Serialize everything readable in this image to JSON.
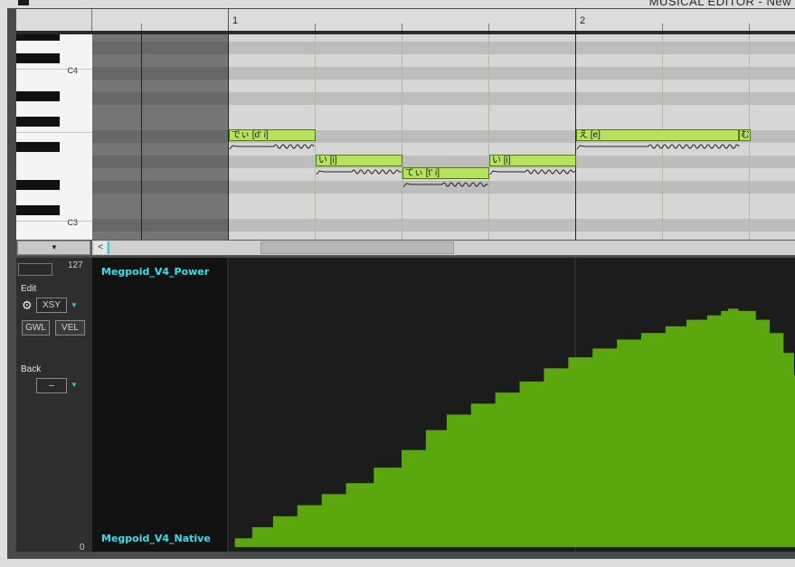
{
  "window": {
    "title": "MUSICAL EDITOR - New"
  },
  "ruler": {
    "bars": [
      "1",
      "2"
    ]
  },
  "keyboard": {
    "labels": [
      "C4",
      "C3"
    ]
  },
  "notes": [
    {
      "lyric": "でぃ [d' i]"
    },
    {
      "lyric": "い [i]"
    },
    {
      "lyric": "てぃ [t' i]"
    },
    {
      "lyric": "い [i]"
    },
    {
      "lyric": "え [e]"
    },
    {
      "lyric": "む"
    }
  ],
  "scroll": {
    "left_arrow": "<",
    "dropdown_arrow": "▼"
  },
  "control": {
    "max_value": "127",
    "min_value": "0",
    "edit_label": "Edit",
    "mode": "XSY",
    "gwl": "GWL",
    "vel": "VEL",
    "back_label": "Back",
    "back_value": "–"
  },
  "graph": {
    "top_voice": "Megpoid_V4_Power",
    "bottom_voice": "Megpoid_V4_Native"
  },
  "colors": {
    "note_fill": "#b5e35c",
    "curve_fill": "#5aa80e",
    "label_cyan": "#38e0f0"
  },
  "xsy_curve": {
    "y_range": [
      0,
      127
    ],
    "points": [
      [
        0,
        0
      ],
      [
        0.02,
        4
      ],
      [
        0.07,
        9
      ],
      [
        0.13,
        14
      ],
      [
        0.2,
        19
      ],
      [
        0.27,
        24
      ],
      [
        0.34,
        29
      ],
      [
        0.42,
        36
      ],
      [
        0.5,
        44
      ],
      [
        0.57,
        53
      ],
      [
        0.63,
        60
      ],
      [
        0.7,
        65
      ],
      [
        0.77,
        70
      ],
      [
        0.84,
        75
      ],
      [
        0.91,
        81
      ],
      [
        0.98,
        86
      ],
      [
        1.05,
        90
      ],
      [
        1.12,
        94
      ],
      [
        1.19,
        97
      ],
      [
        1.26,
        100
      ],
      [
        1.32,
        103
      ],
      [
        1.38,
        105
      ],
      [
        1.42,
        107
      ],
      [
        1.44,
        108
      ],
      [
        1.47,
        107
      ],
      [
        1.52,
        103
      ],
      [
        1.56,
        97
      ],
      [
        1.6,
        88
      ],
      [
        1.63,
        78
      ]
    ]
  }
}
